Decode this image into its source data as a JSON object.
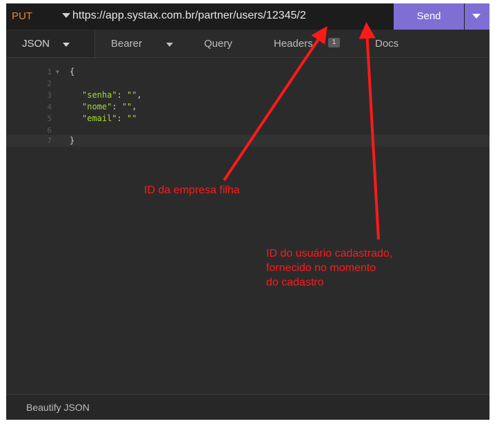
{
  "request": {
    "method": "PUT",
    "url": "https://app.systax.com.br/partner/users/12345/2",
    "send_label": "Send"
  },
  "tabs": {
    "body": "JSON",
    "auth": "Bearer",
    "query": "Query",
    "headers": "Headers",
    "headers_count": "1",
    "docs": "Docs"
  },
  "editor": {
    "lines": [
      {
        "n": "1",
        "text": "{"
      },
      {
        "n": "2",
        "text": ""
      },
      {
        "n": "3",
        "key": "\"senha\"",
        "value": "\"\"",
        "suffix": ","
      },
      {
        "n": "4",
        "key": "\"nome\"",
        "value": "\"\"",
        "suffix": ","
      },
      {
        "n": "5",
        "key": "\"email\"",
        "value": "\"\"",
        "suffix": ""
      },
      {
        "n": "6",
        "text": ""
      },
      {
        "n": "7",
        "text": "}"
      }
    ]
  },
  "footer": {
    "beautify_label": "Beautify JSON"
  },
  "annotations": {
    "company_id_note": "ID da empresa filha",
    "user_id_note": [
      "ID do usuário cadastrado,",
      "fornecido no momento",
      "do cadastro"
    ],
    "color": "#ff1a1a"
  }
}
